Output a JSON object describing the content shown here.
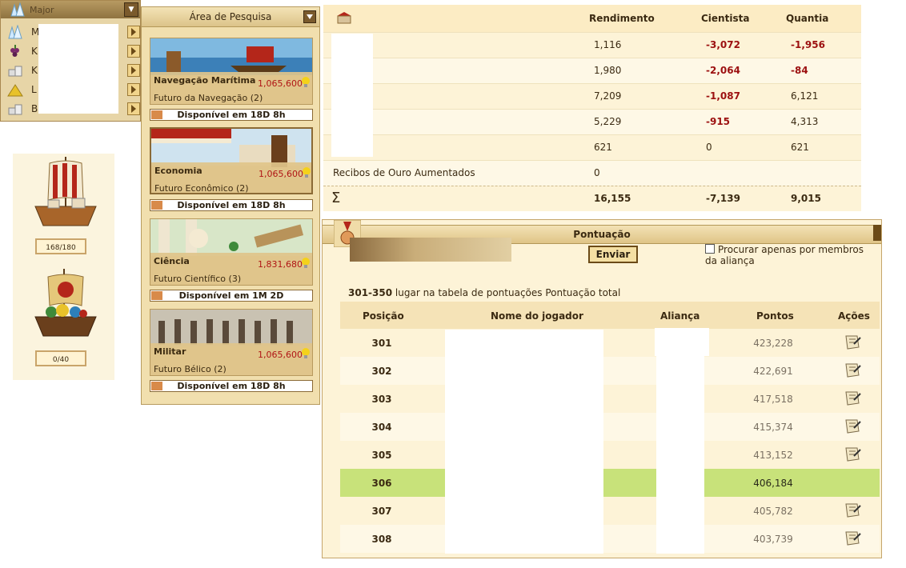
{
  "city_selector": {
    "title": "Major",
    "items": [
      {
        "initial": "M",
        "icon": "crystal-icon"
      },
      {
        "initial": "K",
        "icon": "grapes-icon"
      },
      {
        "initial": "K",
        "icon": "marble-icon"
      },
      {
        "initial": "L",
        "icon": "sulfur-icon"
      },
      {
        "initial": "B",
        "icon": "marble-icon"
      }
    ]
  },
  "ships": [
    {
      "label": "168/180",
      "icon": "merchant-ship-icon"
    },
    {
      "label": "0/40",
      "icon": "cargo-ship-icon"
    }
  ],
  "research": {
    "title": "Área de Pesquisa",
    "cards": [
      {
        "name": "Navegação Marítima",
        "cost": "1,065,600",
        "sub": "Futuro da Navegação (2)",
        "status": "Disponível em 18D 8h"
      },
      {
        "name": "Economia",
        "cost": "1,065,600",
        "sub": "Futuro Econômico (2)",
        "status": "Disponível em 18D 8h"
      },
      {
        "name": "Ciência",
        "cost": "1,831,680",
        "sub": "Futuro Científico (3)",
        "status": "Disponível em 1M 2D"
      },
      {
        "name": "Militar",
        "cost": "1,065,600",
        "sub": "Futuro Bélico (2)",
        "status": "Disponível em 18D 8h"
      }
    ]
  },
  "economy": {
    "headers": {
      "rendimento": "Rendimento",
      "cientista": "Cientista",
      "quantia": "Quantia"
    },
    "rows": [
      {
        "label": "",
        "rendimento": "1,116",
        "cientista": "-3,072",
        "quantia": "-1,956"
      },
      {
        "label": "",
        "rendimento": "1,980",
        "cientista": "-2,064",
        "quantia": "-84"
      },
      {
        "label": "",
        "rendimento": "7,209",
        "cientista": "-1,087",
        "quantia": "6,121"
      },
      {
        "label": "",
        "rendimento": "5,229",
        "cientista": "-915",
        "quantia": "4,313"
      },
      {
        "label": "",
        "rendimento": "621",
        "cientista": "0",
        "quantia": "621"
      },
      {
        "label": "Recibos de Ouro Aumentados",
        "rendimento": "0",
        "cientista": "",
        "quantia": ""
      }
    ],
    "total": {
      "symbol": "Σ",
      "rendimento": "16,155",
      "cientista": "-7,139",
      "quantia": "9,015"
    }
  },
  "score": {
    "title": "Pontuação",
    "send_label": "Enviar",
    "only_members_label": "Procurar apenas por membros da aliança",
    "rank_range": "301-350",
    "rank_text": "lugar na tabela de pontuações Pontuação total",
    "headers": {
      "pos": "Posição",
      "player": "Nome do jogador",
      "alliance": "Aliança",
      "points": "Pontos",
      "actions": "Ações"
    },
    "rows": [
      {
        "pos": "301",
        "points": "423,228",
        "action": true
      },
      {
        "pos": "302",
        "points": "422,691",
        "action": true
      },
      {
        "pos": "303",
        "points": "417,518",
        "action": true
      },
      {
        "pos": "304",
        "points": "415,374",
        "action": true
      },
      {
        "pos": "305",
        "points": "413,152",
        "action": true
      },
      {
        "pos": "306",
        "points": "406,184",
        "action": false,
        "current": true
      },
      {
        "pos": "307",
        "points": "405,782",
        "action": true
      },
      {
        "pos": "308",
        "points": "403,739",
        "action": true
      }
    ]
  },
  "colors": {
    "highlight_row": "#c8e27a",
    "negative": "#9c1010",
    "cost": "#b01515"
  }
}
